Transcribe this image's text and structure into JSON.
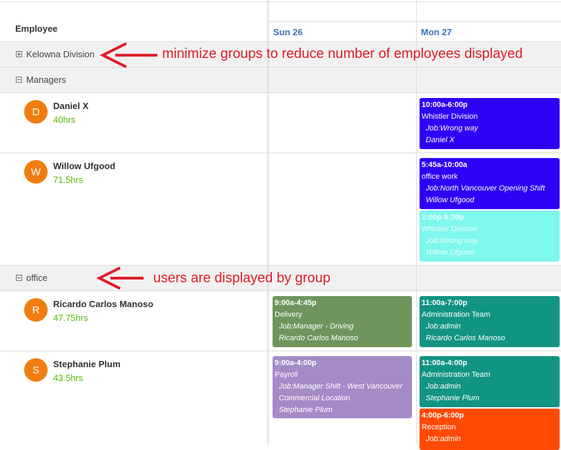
{
  "header": {
    "employee": "Employee",
    "days": [
      "Sun 26",
      "Mon 27"
    ]
  },
  "groups": {
    "kelowna": "Kelowna Division",
    "managers": "Managers",
    "office": "office"
  },
  "employees": [
    {
      "initial": "D",
      "name": "Daniel X",
      "hours": "40hrs"
    },
    {
      "initial": "W",
      "name": "Willow Ufgood",
      "hours": "71.5hrs"
    },
    {
      "initial": "R",
      "name": "Ricardo Carlos Manoso",
      "hours": "47.75hrs"
    },
    {
      "initial": "S",
      "name": "Stephanie Plum",
      "hours": "43.5hrs"
    }
  ],
  "shifts": [
    {
      "time": "10:00a-6:00p",
      "location": "Whistler Division",
      "job": "Job:Wrong way",
      "who": "Daniel X",
      "color": "#2e00f4"
    },
    {
      "time": "5:45a-10:00a",
      "location": "office work",
      "job": "Job:North Vancouver Opening Shift",
      "who": "Willow Ufgood",
      "color": "#2e00f4"
    },
    {
      "time": "1:00p-9:30p",
      "location": "Whistler Division",
      "job": "Job:Wrong way",
      "who": "Willow Ufgood",
      "color": "#7ef7ec"
    },
    {
      "time": "9:00a-4:45p",
      "location": "Delivery",
      "job": "Job:Manager - Driving",
      "who": "Ricardo Carlos Manoso",
      "color": "#6f955c"
    },
    {
      "time": "11:00a-7:00p",
      "location": "Administration Team",
      "job": "Job:admin",
      "who": "Ricardo Carlos Manoso",
      "color": "#129482"
    },
    {
      "time": "9:00a-4:00p",
      "location": "Payroll",
      "job": "Job:Manager Shift - West Vancouver Commercial Location",
      "who": "Stephanie Plum",
      "color": "#a48ac7"
    },
    {
      "time": "11:00a-4:00p",
      "location": "Administration Team",
      "job": "Job:admin",
      "who": "Stephanie Plum",
      "color": "#129482"
    },
    {
      "time": "4:00p-6:00p",
      "location": "Reception",
      "job": "Job:admin",
      "who": "",
      "color": "#ff4a06"
    }
  ],
  "annotations": {
    "groups_note": "minimize groups to reduce number of employees displayed",
    "users_note": "users are displayed by group",
    "arrow_color": "#e01c28"
  }
}
